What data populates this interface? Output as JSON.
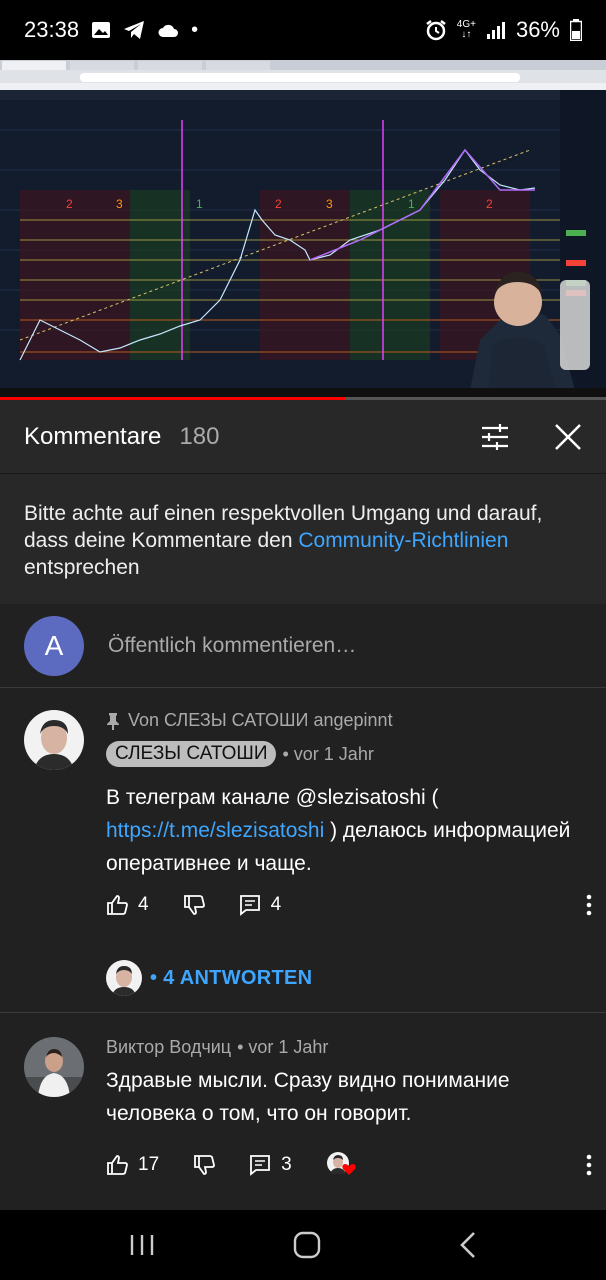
{
  "status_bar": {
    "time": "23:38",
    "network": "4G+",
    "battery": "36%"
  },
  "video": {
    "progress_percent": 57
  },
  "comments_header": {
    "title": "Kommentare",
    "count": "180"
  },
  "guidelines": {
    "text": "Bitte achte auf einen respektvollen Umgang und darauf, dass deine Kommentare den ",
    "link": "Community-Richtlinien",
    "text_after": " entsprechen"
  },
  "add_comment": {
    "avatar_letter": "A",
    "placeholder": "Öffentlich kommentieren…"
  },
  "comments": [
    {
      "pinned_label": "Von СЛЕЗЫ САТОШИ angepinnt",
      "author": "СЛЕЗЫ САТОШИ",
      "time": "• vor 1 Jahr",
      "text_before": "В телеграм канале @slezisatoshi ( ",
      "link": "https://t.me/slezisatoshi",
      "text_after": " ) делаюсь информацией оперативнее и чаще.",
      "likes": "4",
      "replies_count": "4",
      "replies_label": "• 4 ANTWORTEN"
    },
    {
      "author": "Виктор Водчиц",
      "time": "• vor 1 Jahr",
      "text": "Здравые мысли. Сразу видно понимание человека о том, что он говорит.",
      "likes": "17",
      "replies_count": "3"
    }
  ],
  "colors": {
    "accent_link": "#3ea6ff",
    "progress": "#ff0000",
    "heart": "#ff0000"
  }
}
